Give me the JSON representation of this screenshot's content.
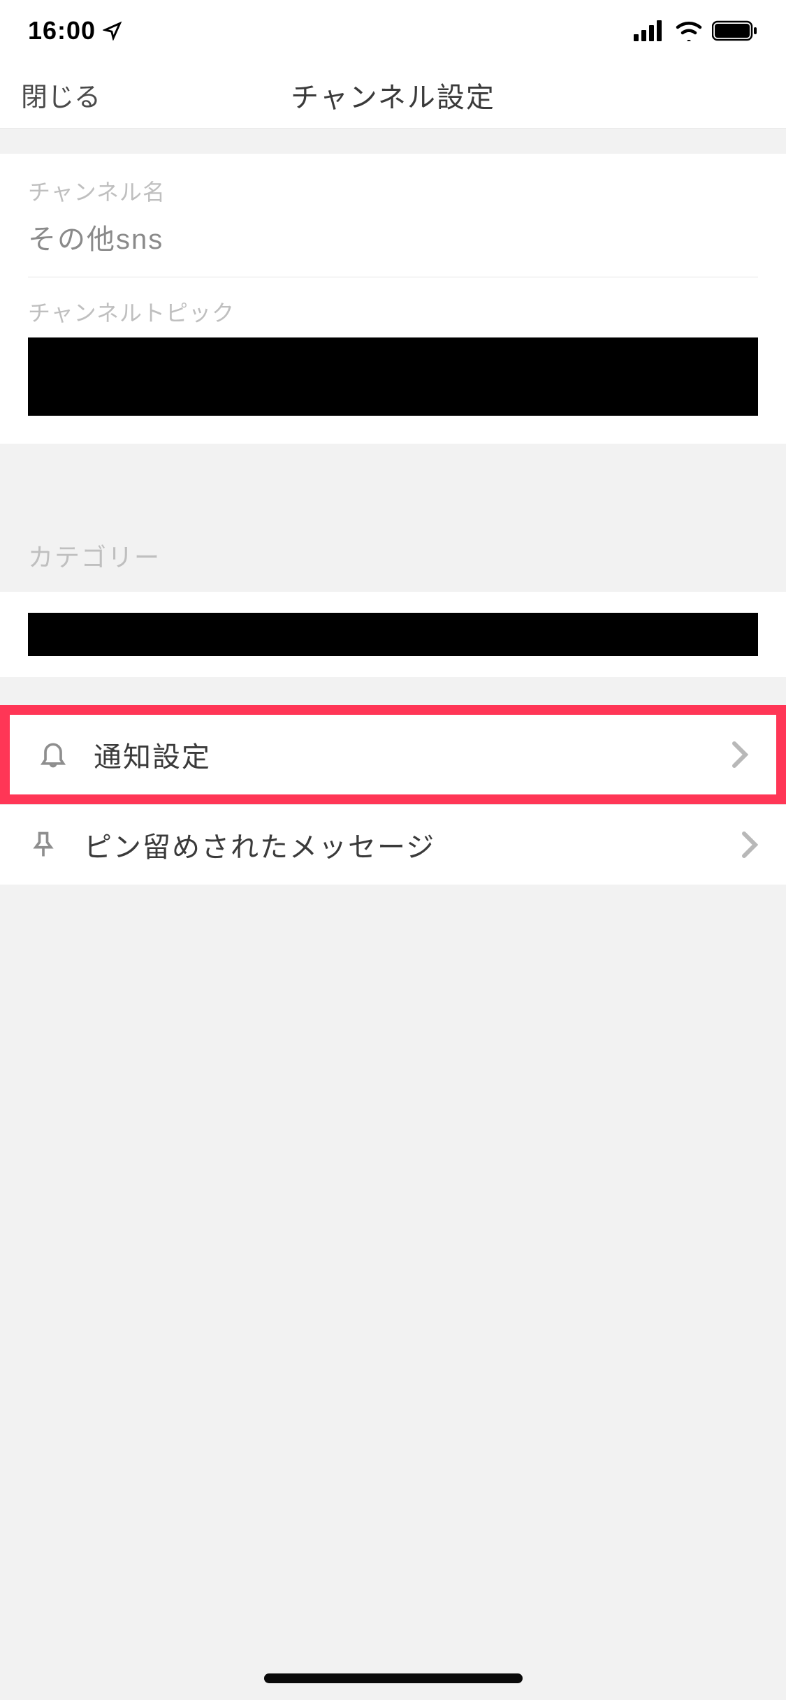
{
  "status": {
    "time": "16:00"
  },
  "nav": {
    "close": "閉じる",
    "title": "チャンネル設定"
  },
  "fields": {
    "channel_name_label": "チャンネル名",
    "channel_name_value": "その他sns",
    "channel_topic_label": "チャンネルトピック"
  },
  "category": {
    "label": "カテゴリー"
  },
  "menu": {
    "notifications": "通知設定",
    "pinned": "ピン留めされたメッセージ"
  }
}
